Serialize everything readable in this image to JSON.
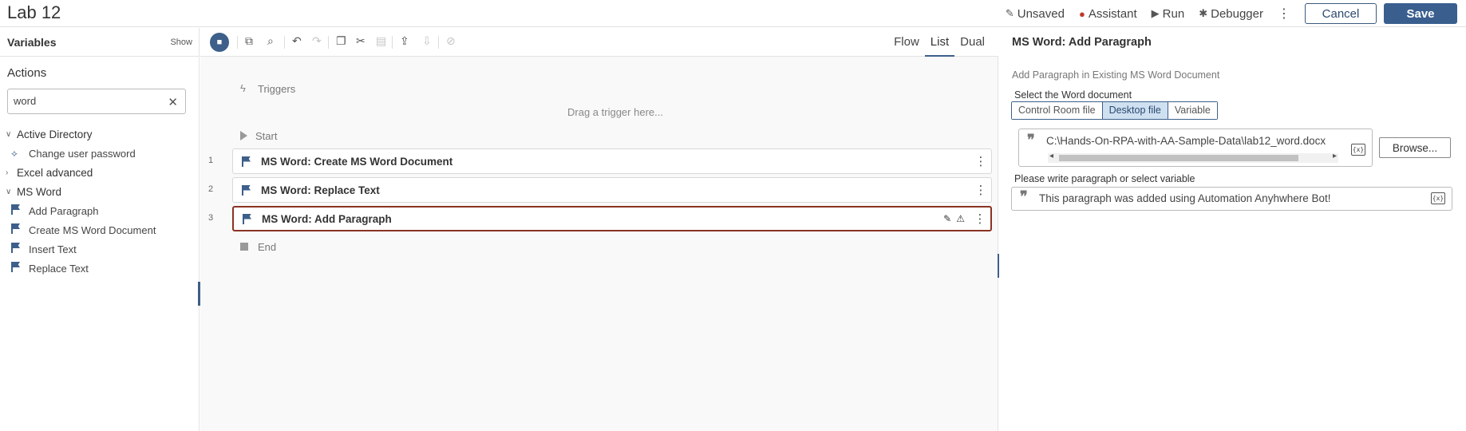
{
  "header": {
    "title": "Lab 12",
    "unsaved_label": "Unsaved",
    "assistant_label": "Assistant",
    "run_label": "Run",
    "debugger_label": "Debugger",
    "cancel_label": "Cancel",
    "save_label": "Save"
  },
  "left_panel": {
    "variables_title": "Variables",
    "show_label": "Show",
    "actions_title": "Actions",
    "search": {
      "value": "word",
      "placeholder": ""
    },
    "tree": {
      "active_directory": {
        "label": "Active Directory",
        "expanded": true,
        "items": [
          "Change user password"
        ]
      },
      "excel_advanced": {
        "label": "Excel advanced",
        "expanded": false
      },
      "ms_word": {
        "label": "MS Word",
        "expanded": true,
        "items": [
          "Add Paragraph",
          "Create MS Word Document",
          "Insert Text",
          "Replace Text"
        ]
      }
    }
  },
  "center": {
    "view_tabs": [
      "Flow",
      "List",
      "Dual"
    ],
    "active_view": "List",
    "triggers_label": "Triggers",
    "drag_hint": "Drag a trigger here...",
    "start_label": "Start",
    "end_label": "End",
    "steps": [
      {
        "num": "1",
        "label": "MS Word: Create MS Word Document"
      },
      {
        "num": "2",
        "label": "MS Word: Replace Text"
      },
      {
        "num": "3",
        "label": "MS Word: Add Paragraph"
      }
    ]
  },
  "right_panel": {
    "title": "MS Word: Add Paragraph",
    "description": "Add Paragraph in Existing MS Word Document",
    "select_doc_label": "Select the Word document",
    "source_options": [
      "Control Room file",
      "Desktop file",
      "Variable"
    ],
    "selected_source": "Desktop file",
    "file_path": "C:\\Hands-On-RPA-with-AA-Sample-Data\\lab12_word.docx",
    "browse_label": "Browse...",
    "paragraph_label": "Please write paragraph or select variable",
    "paragraph_value": "This paragraph was added using Automation Anyhwhere Bot!",
    "variable_icon_text": "{x}"
  },
  "colors": {
    "accent": "#3d5f8a",
    "selected_step_border": "#8a3324",
    "segment_active_bg": "#cfe0f0"
  },
  "icons": {
    "record": "video-camera-icon",
    "unsaved": "edit-icon",
    "assistant": "assistant-icon",
    "run": "play-icon",
    "debugger": "bug-icon"
  }
}
